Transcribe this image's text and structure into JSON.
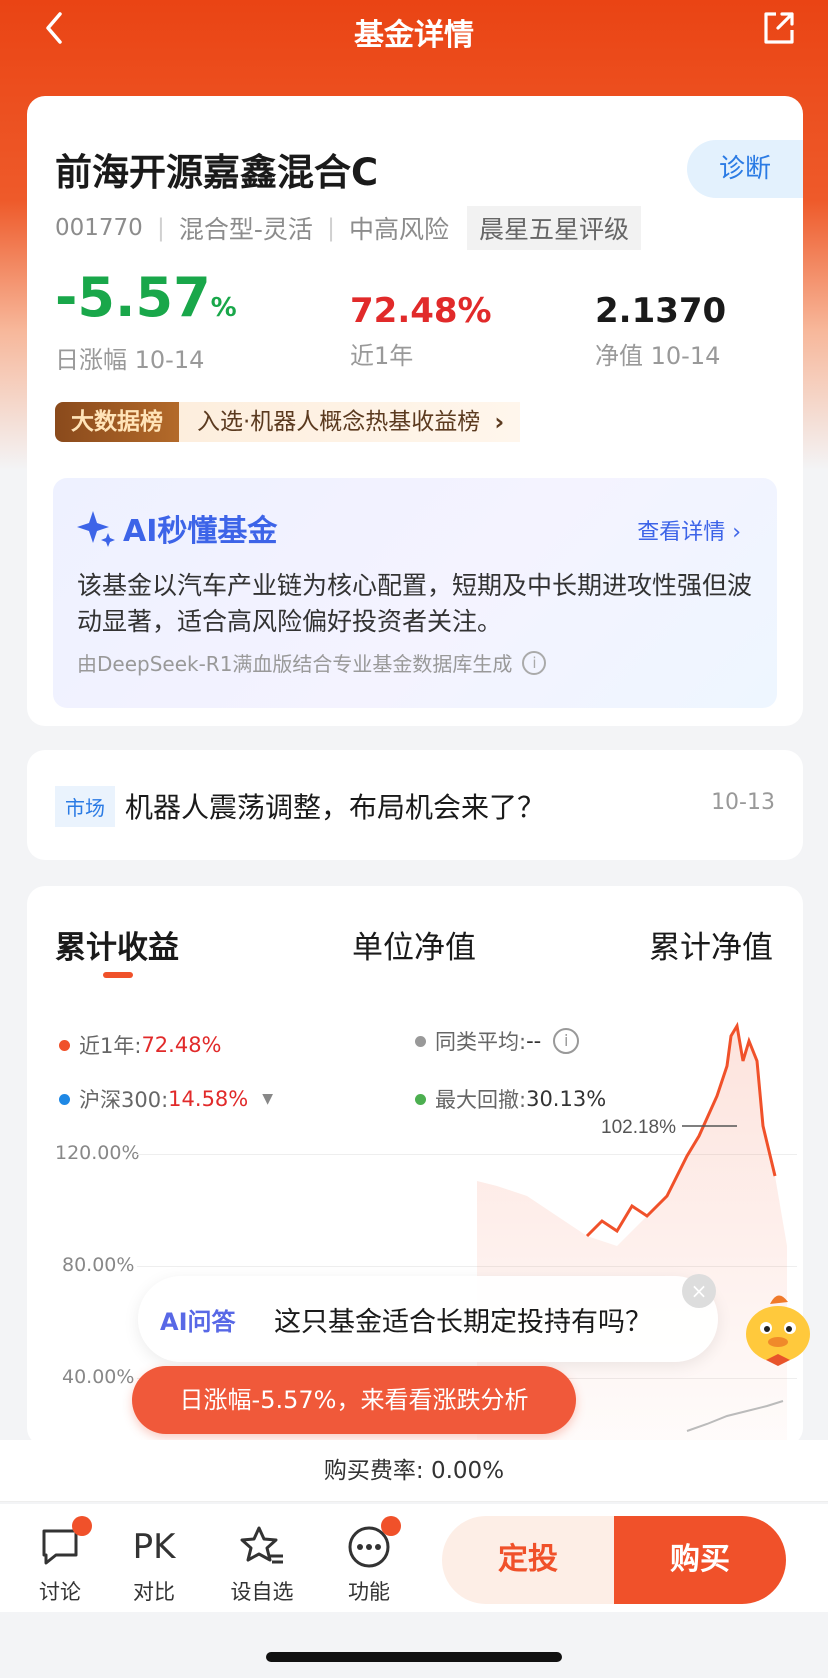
{
  "nav": {
    "title": "基金详情",
    "back_icon": "chevron-left-icon",
    "share_icon": "share-icon"
  },
  "fund": {
    "name": "前海开源嘉鑫混合C",
    "diagnose_label": "诊断",
    "code": "001770",
    "category": "混合型-灵活",
    "risk": "中高风险",
    "rating": "晨星五星评级",
    "daily_change": "-5.57",
    "daily_change_unit": "%",
    "daily_change_label": "日涨幅 10-14",
    "year_return": "72.48%",
    "year_return_label": "近1年",
    "nav_value": "2.1370",
    "nav_label": "净值 10-14"
  },
  "rank": {
    "badge": "大数据榜",
    "text": "入选·机器人概念热基收益榜",
    "chevron": "›"
  },
  "ai_summary": {
    "title": "AI秒懂基金",
    "more": "查看详情 ›",
    "body": "该基金以汽车产业链为核心配置，短期及中长期进攻性强但波动显著，适合高风险偏好投资者关注。",
    "footer": "由DeepSeek-R1满血版结合专业基金数据库生成",
    "info_glyph": "i"
  },
  "news": {
    "tag": "市场",
    "title": "机器人震荡调整，布局机会来了？",
    "date": "10-13"
  },
  "chart": {
    "tabs": [
      "累计收益",
      "单位净值",
      "累计净值"
    ],
    "active_tab": 0,
    "legend": {
      "year_label": "近1年: ",
      "year_value": "72.48%",
      "peer_label": "同类平均: ",
      "peer_value": "--",
      "csi_label": "沪深300: ",
      "csi_value": "14.58%",
      "drawdown_label": "最大回撤: ",
      "drawdown_value": "30.13%",
      "info_glyph": "i",
      "caret": "▼"
    },
    "y_labels": [
      "120.00%",
      "80.00%",
      "40.00%"
    ],
    "peak_label": "102.18%",
    "colors": {
      "fund": "#f0512a",
      "peer": "#999999",
      "csi": "#1e88e5",
      "drawdown": "#4caf50"
    }
  },
  "chart_data": {
    "type": "line",
    "ylim": [
      0,
      120
    ],
    "series": [
      {
        "name": "近1年",
        "values": [
          100.13,
          78,
          102.18,
          100,
          72.48
        ]
      }
    ],
    "yticks": [
      "120.00%",
      "80.00%",
      "40.00%"
    ],
    "annotations": [
      "102.18%"
    ]
  },
  "ai_ask": {
    "label": "AI问答",
    "question": "这只基金适合长期定投持有吗？",
    "close": "×"
  },
  "promo": {
    "text": "日涨幅-5.57%，来看看涨跌分析"
  },
  "fee": {
    "text": "购买费率: 0.00%"
  },
  "bottom": {
    "discuss": "讨论",
    "compare": "对比",
    "compare_glyph": "PK",
    "watch": "设自选",
    "function": "功能",
    "fixed_invest": "定投",
    "buy": "购买"
  }
}
